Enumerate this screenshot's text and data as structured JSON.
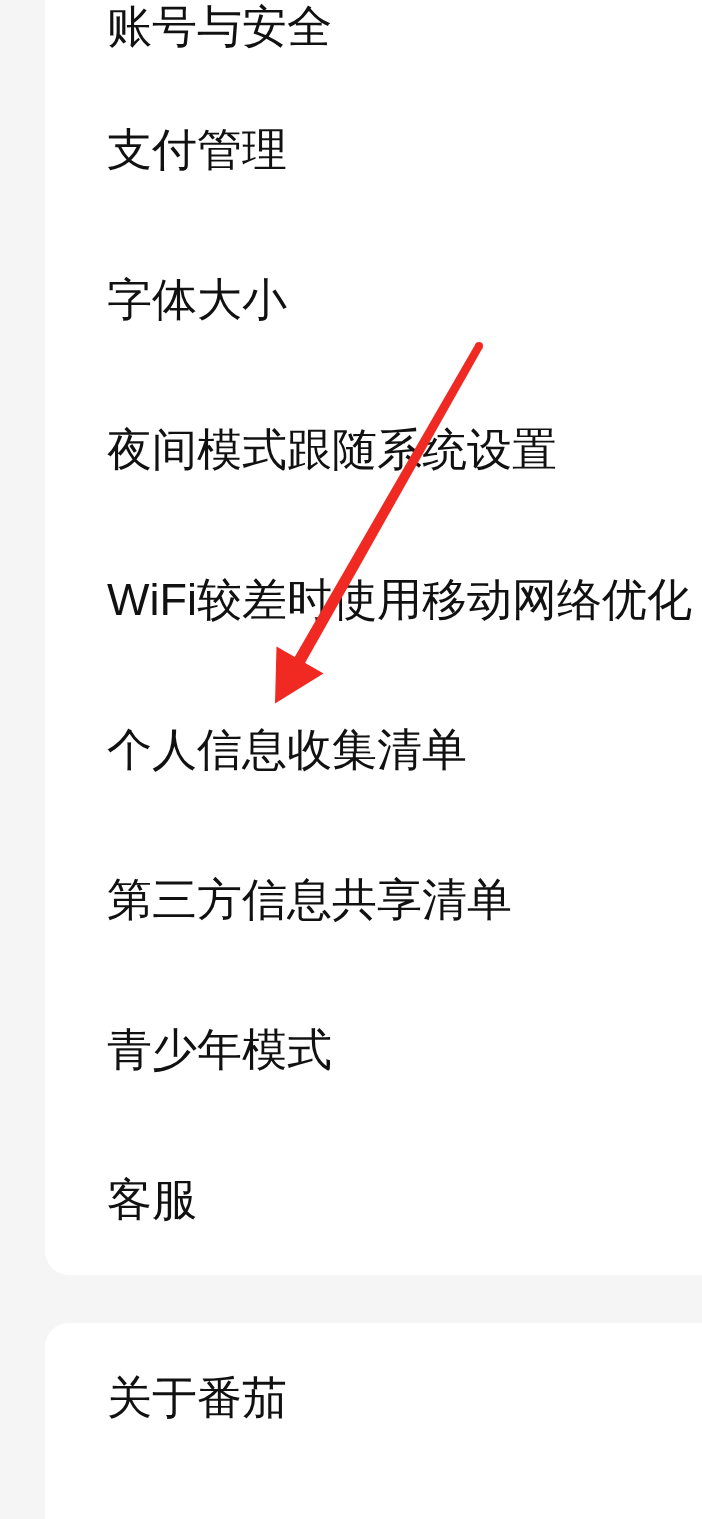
{
  "settings_groups": [
    {
      "items": [
        {
          "label": "账号与安全"
        },
        {
          "label": "支付管理"
        },
        {
          "label": "字体大小"
        },
        {
          "label": "夜间模式跟随系统设置"
        },
        {
          "label": "WiFi较差时使用移动网络优化"
        },
        {
          "label": "个人信息收集清单"
        },
        {
          "label": "第三方信息共享清单"
        },
        {
          "label": "青少年模式"
        },
        {
          "label": "客服"
        }
      ]
    },
    {
      "items": [
        {
          "label": "关于番茄"
        }
      ]
    }
  ],
  "annotations": [
    {
      "kind": "arrow"
    }
  ]
}
